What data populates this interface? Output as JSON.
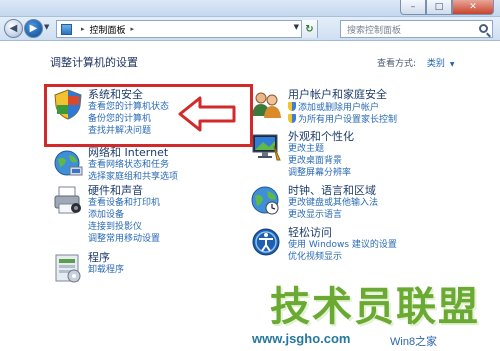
{
  "window": {
    "minimize_glyph": "–",
    "maximize_glyph": "□",
    "close_glyph": "✕"
  },
  "address_bar": {
    "back_glyph": "◀",
    "forward_glyph": "▶",
    "dropdown_glyph": "▼",
    "crumb_separator": "▸",
    "crumb": "控制面板",
    "refresh_glyph": "↻",
    "search_placeholder": "搜索控制面板"
  },
  "header": {
    "title": "调整计算机的设置",
    "view_label": "查看方式:",
    "view_value": "类别",
    "view_arrow": "▼"
  },
  "categories": [
    {
      "heading": "系统和安全",
      "icon": "shield-flag-icon",
      "links": [
        "查看您的计算机状态",
        "备份您的计算机",
        "查找并解决问题"
      ]
    },
    {
      "heading": "网络和 Internet",
      "icon": "globe-network-icon",
      "links": [
        "查看网络状态和任务",
        "选择家庭组和共享选项"
      ]
    },
    {
      "heading": "硬件和声音",
      "icon": "printer-icon",
      "links": [
        "查看设备和打印机",
        "添加设备",
        "连接到投影仪",
        "调整常用移动设置"
      ]
    },
    {
      "heading": "程序",
      "icon": "programs-icon",
      "links": [
        "卸载程序"
      ]
    },
    {
      "heading": "用户帐户和家庭安全",
      "icon": "users-icon",
      "links": [
        "添加或删除用户帐户",
        "为所有用户设置家长控制"
      ]
    },
    {
      "heading": "外观和个性化",
      "icon": "monitor-icon",
      "links": [
        "更改主题",
        "更改桌面背景",
        "调整屏幕分辨率"
      ]
    },
    {
      "heading": "时钟、语言和区域",
      "icon": "clock-globe-icon",
      "links": [
        "更改键盘或其他输入法",
        "更改显示语言"
      ]
    },
    {
      "heading": "轻松访问",
      "icon": "accessibility-icon",
      "links": [
        "使用 Windows 建议的设置",
        "优化视频显示"
      ]
    }
  ],
  "watermark": {
    "text": "技术员联盟",
    "url": "www.jsgho.com",
    "url2": "Win8之家"
  },
  "colors": {
    "highlight": "#d22a2a",
    "link": "#2a6bb5",
    "heading": "#1e3d6b",
    "watermark": "#6aa932"
  }
}
